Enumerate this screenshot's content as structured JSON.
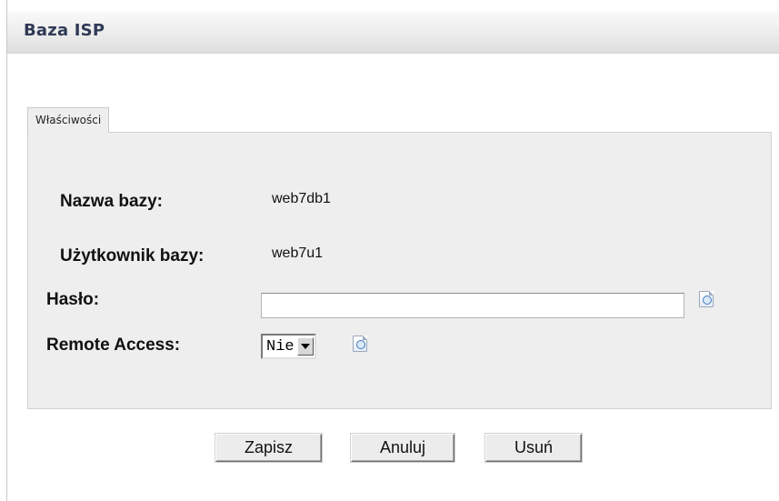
{
  "header": {
    "title": "Baza ISP"
  },
  "tabs": [
    {
      "label": "Właściwości"
    }
  ],
  "form": {
    "db_name_label": "Nazwa bazy:",
    "db_name_value": "web7db1",
    "db_user_label": "Użytkownik bazy:",
    "db_user_value": "web7u1",
    "password_label": "Hasło:",
    "password_value": "",
    "remote_access_label": "Remote Access:",
    "remote_access_value": "Nie"
  },
  "buttons": {
    "save": "Zapisz",
    "cancel": "Anuluj",
    "delete": "Usuń"
  },
  "icons": {
    "password_help": "info-icon",
    "remote_access_help": "info-icon"
  }
}
